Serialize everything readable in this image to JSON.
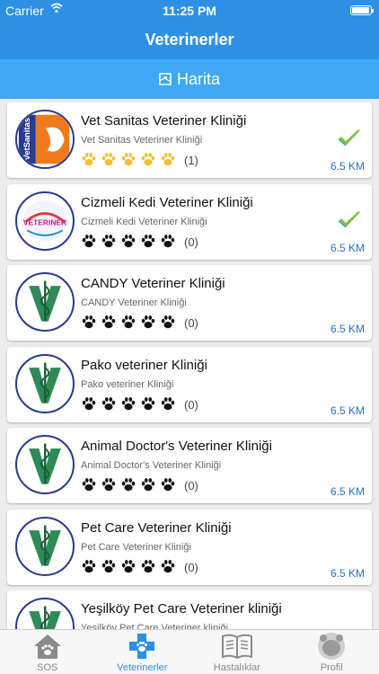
{
  "status_bar": {
    "carrier": "Carrier",
    "time": "11:25 PM"
  },
  "nav": {
    "title": "Veterinerler"
  },
  "map_bar": {
    "label": "Harita",
    "icon": "map-icon"
  },
  "clinics": [
    {
      "name": "Vet Sanitas Veteriner Kliniği",
      "subtitle": "Vet Sanitas Veteriner Kliniği",
      "rating": 5,
      "reviews": "(1)",
      "distance": "6.5 KM",
      "verified": true,
      "logo": "vetsanitas-logo",
      "logo_text": "VetSanitas"
    },
    {
      "name": "Cizmeli Kedi Veteriner Kliniği",
      "subtitle": "Cizmeli Kedi Veteriner Kliniği",
      "rating": 0,
      "reviews": "(0)",
      "distance": "6.5 KM",
      "verified": true,
      "logo": "cizmeli-kedi-logo",
      "logo_text": "VETERINER"
    },
    {
      "name": "CANDY Veteriner Kliniği",
      "subtitle": "CANDY Veteriner Kliniği",
      "rating": 0,
      "reviews": "(0)",
      "distance": "6.5 KM",
      "verified": false,
      "logo": "vet-caduceus-logo"
    },
    {
      "name": "Pako veteriner Kliniği",
      "subtitle": "Pako veteriner Kliniği",
      "rating": 0,
      "reviews": "(0)",
      "distance": "6.5 KM",
      "verified": false,
      "logo": "vet-caduceus-logo"
    },
    {
      "name": "Animal Doctor's Veteriner Kliniği",
      "subtitle": "Animal Doctor's Veteriner Kliniği",
      "rating": 0,
      "reviews": "(0)",
      "distance": "6.5 KM",
      "verified": false,
      "logo": "vet-caduceus-logo"
    },
    {
      "name": "Pet Care Veteriner Kliniği",
      "subtitle": "Pet Care Veteriner Kliniği",
      "rating": 0,
      "reviews": "(0)",
      "distance": "6.5 KM",
      "verified": false,
      "logo": "vet-caduceus-logo"
    },
    {
      "name": "Yeşilköy Pet Care Veteriner kliniği",
      "subtitle": "Yeşilköy Pet Care Veteriner kliniği",
      "rating": 0,
      "reviews": "",
      "distance": "",
      "verified": false,
      "logo": "vet-caduceus-logo"
    }
  ],
  "tabs": [
    {
      "label": "SOS",
      "icon": "house-paw-icon",
      "active": false
    },
    {
      "label": "Veterinerler",
      "icon": "medical-paw-icon",
      "active": true
    },
    {
      "label": "Hastalıklar",
      "icon": "book-icon",
      "active": false
    },
    {
      "label": "Profil",
      "icon": "bear-avatar-icon",
      "active": false
    }
  ],
  "colors": {
    "primary": "#2d90e4",
    "map_bar": "#3ea8f5",
    "paw_gold": "#f2c12e",
    "paw_dark": "#111111",
    "check_green": "#7bc143",
    "distance": "#2d72b8",
    "vet_green": "#2e8b57"
  }
}
